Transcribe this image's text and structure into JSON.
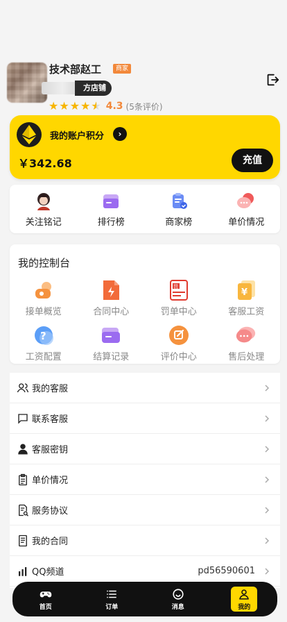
{
  "profile": {
    "name": "技术部赵工",
    "merchant_tag": "商家",
    "shop_label": "方店铺",
    "rating_score": "4.3",
    "rating_count": "(5条评价)",
    "stars": 4.5
  },
  "points": {
    "title": "我的账户积分",
    "value": "￥342.68",
    "recharge": "充值"
  },
  "quick_links": [
    {
      "label": "关注铭记",
      "icon": "avatar-icon"
    },
    {
      "label": "排行榜",
      "icon": "ranking-icon"
    },
    {
      "label": "商家榜",
      "icon": "clipboard-icon"
    },
    {
      "label": "单价情况",
      "icon": "chat-bubble-icon"
    }
  ],
  "console": {
    "title": "我的控制台",
    "items": [
      {
        "label": "接单概览",
        "icon": "overview-icon"
      },
      {
        "label": "合同中心",
        "icon": "contract-icon"
      },
      {
        "label": "罚单中心",
        "icon": "penalty-icon"
      },
      {
        "label": "客服工资",
        "icon": "salary-icon"
      },
      {
        "label": "工资配置",
        "icon": "question-icon"
      },
      {
        "label": "结算记录",
        "icon": "settlement-icon"
      },
      {
        "label": "评价中心",
        "icon": "review-icon"
      },
      {
        "label": "售后处理",
        "icon": "aftersale-icon"
      }
    ]
  },
  "menu": [
    {
      "label": "我的客服",
      "value": "",
      "icon": "users-icon"
    },
    {
      "label": "联系客服",
      "value": "",
      "icon": "message-icon"
    },
    {
      "label": "客服密钥",
      "value": "",
      "icon": "user-icon"
    },
    {
      "label": "单价情况",
      "value": "",
      "icon": "clipboard-icon"
    },
    {
      "label": "服务协议",
      "value": "",
      "icon": "document-search-icon"
    },
    {
      "label": "我的合同",
      "value": "",
      "icon": "document-icon"
    },
    {
      "label": "QQ频道",
      "value": "pd56590601",
      "icon": "bar-chart-icon"
    }
  ],
  "tabs": [
    {
      "label": "首页",
      "icon": "gamepad-icon"
    },
    {
      "label": "订单",
      "icon": "list-icon"
    },
    {
      "label": "消息",
      "icon": "smile-icon"
    },
    {
      "label": "我的",
      "icon": "user-icon",
      "active": true
    }
  ],
  "colors": {
    "accent": "#ffd700",
    "dark": "#111111",
    "orange": "#f2883a",
    "star": "#f7b500"
  }
}
